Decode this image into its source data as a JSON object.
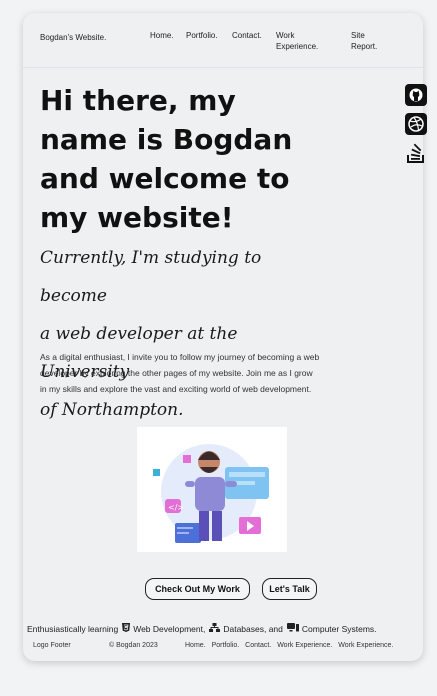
{
  "header": {
    "brand": "Bogdan's Website.",
    "nav": {
      "home": "Home.",
      "portfolio": "Portfolio.",
      "contact": "Contact.",
      "work_line1": "Work",
      "work_line2": "Experience.",
      "report_line1": "Site",
      "report_line2": "Report."
    }
  },
  "hero": {
    "line1": "Hi there, my",
    "line2": "name is Bogdan",
    "line3": "and welcome to",
    "line4": "my website!"
  },
  "subtitle": {
    "line1": "Currently, I'm studying to become",
    "line2": "a web developer at the University",
    "line3": "of Northampton."
  },
  "intro": "As a digital enthusiast, I invite you to follow my journey of becoming a web developer by exploring the other pages of my website. Join me as I grow in my skills and explore the vast and exciting world of web development.",
  "buttons": {
    "work": "Check Out My Work",
    "talk": "Let's Talk"
  },
  "enthusiasm": {
    "prefix": "Enthusiastically learning",
    "item1": "Web Development,",
    "item2": "Databases, and",
    "item3": "Computer Systems."
  },
  "footer": {
    "logo": "Logo Footer",
    "copyright": "© Bogdan 2023",
    "links": [
      "Home.",
      "Portfolio.",
      "Contact.",
      "Work Experience.",
      "Work Experience."
    ]
  },
  "side_icons": [
    "github-icon",
    "dribbble-icon",
    "stackoverflow-icon"
  ],
  "colors": {
    "background": "#f2f3f5",
    "card": "#eef0f2",
    "text": "#111111"
  }
}
